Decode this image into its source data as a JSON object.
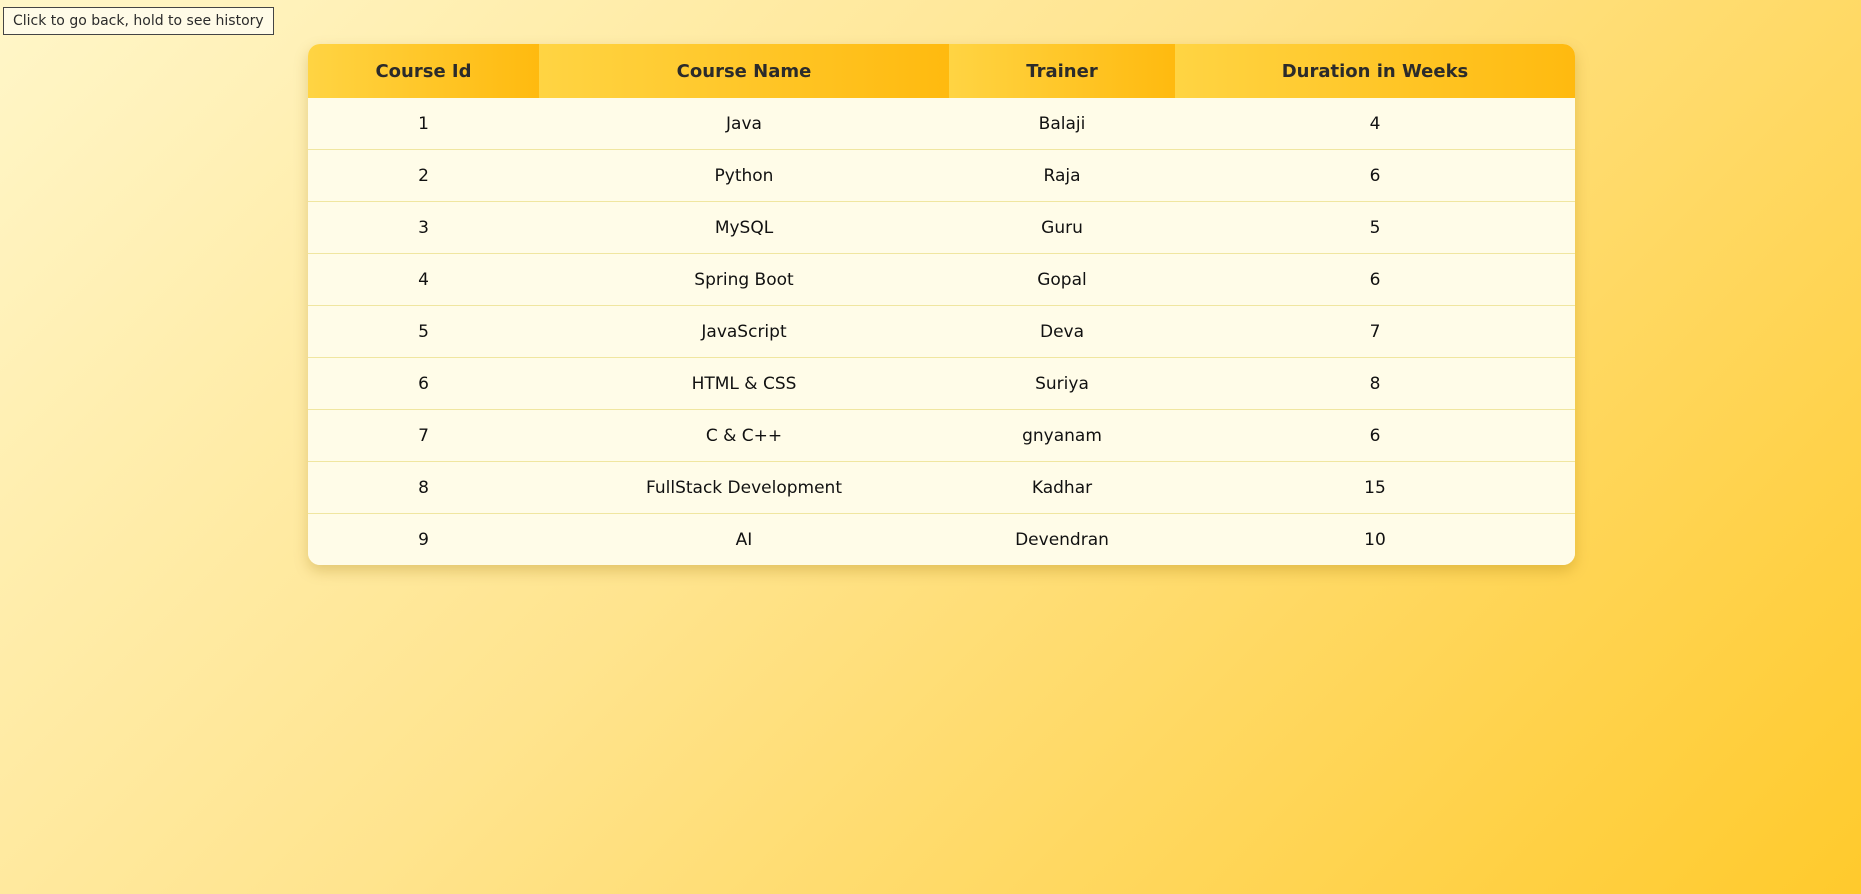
{
  "tooltip": {
    "text": "Click to go back, hold to see history"
  },
  "table": {
    "headers": [
      "Course Id",
      "Course Name",
      "Trainer",
      "Duration in Weeks"
    ],
    "rows": [
      [
        "1",
        "Java",
        "Balaji",
        "4"
      ],
      [
        "2",
        "Python",
        "Raja",
        "6"
      ],
      [
        "3",
        "MySQL",
        "Guru",
        "5"
      ],
      [
        "4",
        "Spring Boot",
        "Gopal",
        "6"
      ],
      [
        "5",
        "JavaScript",
        "Deva",
        "7"
      ],
      [
        "6",
        "HTML & CSS",
        "Suriya",
        "8"
      ],
      [
        "7",
        "C & C++",
        "gnyanam",
        "6"
      ],
      [
        "8",
        "FullStack Development",
        "Kadhar",
        "15"
      ],
      [
        "9",
        "AI",
        "Devendran",
        "10"
      ]
    ]
  },
  "colors": {
    "header_gradient_start": "#ffd443",
    "header_gradient_end": "#ffba0f",
    "row_background": "#fffce8",
    "row_divider": "#f0e6a0"
  }
}
